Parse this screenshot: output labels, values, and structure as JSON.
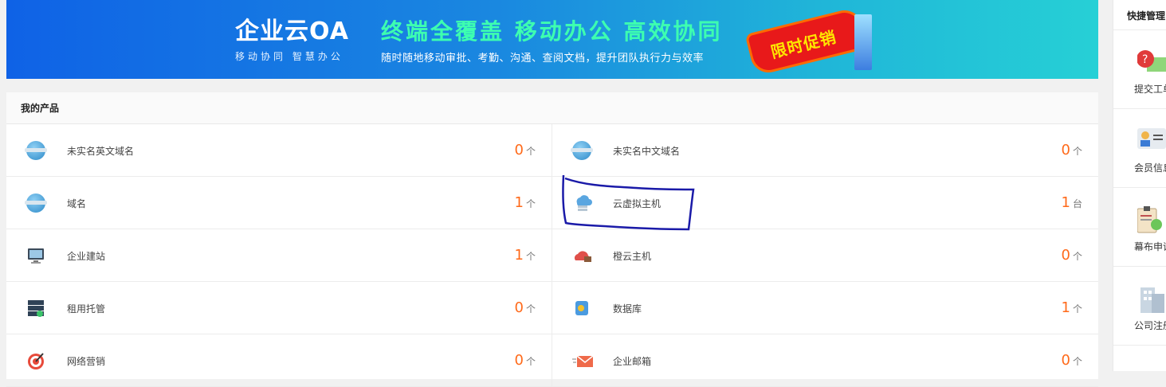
{
  "banner": {
    "brand_name": "企业云OA",
    "brand_sub": "移动协同  智慧办公",
    "slogan_main": "终端全覆盖 移动办公 高效协同",
    "slogan_sub": "随时随地移动审批、考勤、沟通、查阅文档，提升团队执行力与效率",
    "promo_label": "限时促销"
  },
  "products": {
    "title": "我的产品",
    "rows": [
      [
        {
          "label": "未实名英文域名",
          "count": "0",
          "unit": "个",
          "icon": "globe-icon"
        },
        {
          "label": "未实名中文域名",
          "count": "0",
          "unit": "个",
          "icon": "globe-icon"
        }
      ],
      [
        {
          "label": "域名",
          "count": "1",
          "unit": "个",
          "icon": "globe-icon"
        },
        {
          "label": "云虚拟主机",
          "count": "1",
          "unit": "台",
          "icon": "cloud-server-icon"
        }
      ],
      [
        {
          "label": "企业建站",
          "count": "1",
          "unit": "个",
          "icon": "monitor-icon"
        },
        {
          "label": "橙云主机",
          "count": "0",
          "unit": "个",
          "icon": "orange-cloud-icon"
        }
      ],
      [
        {
          "label": "租用托管",
          "count": "0",
          "unit": "个",
          "icon": "server-rack-icon"
        },
        {
          "label": "数据库",
          "count": "1",
          "unit": "个",
          "icon": "database-icon"
        }
      ],
      [
        {
          "label": "网络营销",
          "count": "0",
          "unit": "个",
          "icon": "target-icon"
        },
        {
          "label": "企业邮箱",
          "count": "0",
          "unit": "个",
          "icon": "mail-icon"
        }
      ]
    ]
  },
  "sidebar": {
    "title": "快捷管理",
    "items": [
      {
        "label": "提交工单",
        "icon": "help-ticket-icon"
      },
      {
        "label": "会员信息",
        "icon": "member-card-icon"
      },
      {
        "label": "幕布申请",
        "icon": "clipboard-check-icon"
      },
      {
        "label": "公司注册",
        "icon": "building-icon"
      }
    ]
  },
  "colors": {
    "count": "#ff6a1a",
    "annotation": "#1a1aa8"
  }
}
